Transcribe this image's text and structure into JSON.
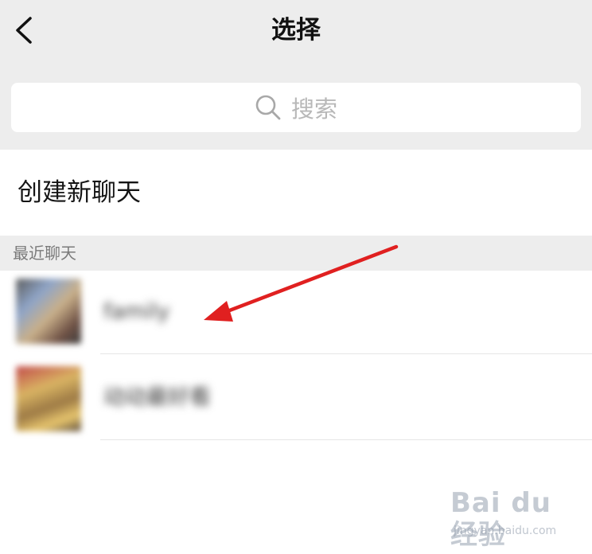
{
  "header": {
    "title": "选择",
    "back_icon": "chevron-left-icon"
  },
  "search": {
    "placeholder": "搜索",
    "icon": "search-icon"
  },
  "new_chat": {
    "label": "创建新聊天"
  },
  "recent_section": {
    "label": "最近聊天"
  },
  "chats": [
    {
      "name": "family",
      "blurred": true
    },
    {
      "name": "动动最好看",
      "blurred": true
    }
  ],
  "annotation": {
    "type": "red-arrow",
    "color": "#e02020",
    "points_to": "chat-item-1"
  },
  "watermark": {
    "logo": "Bai du 经验",
    "url": "jingyan.baidu.com"
  },
  "colors": {
    "header_bg": "#ededed",
    "search_bg": "#ffffff",
    "placeholder": "#b8b8b8",
    "section_text": "#7a7a7a",
    "arrow": "#e02020"
  }
}
